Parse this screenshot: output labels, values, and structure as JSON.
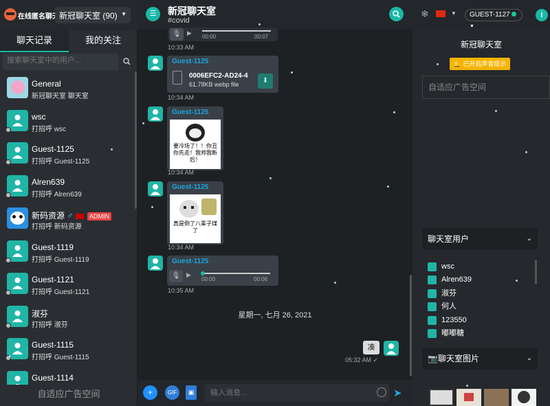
{
  "brand": {
    "name": "在线匿名聊天"
  },
  "room_select": {
    "label": "新冠聊天室 (90)"
  },
  "tabs": [
    {
      "label": "聊天记录"
    },
    {
      "label": "我的关注"
    }
  ],
  "search": {
    "placeholder": "搜索聊天室中的用户..."
  },
  "contacts": [
    {
      "name": "General",
      "message": "新冠聊天室 聊天室"
    },
    {
      "name": "wsc",
      "message": "打招呼 wsc"
    },
    {
      "name": "Guest-1125",
      "message": "打招呼 Guest-1125"
    },
    {
      "name": "Alren639",
      "message": "打招呼 Alren639"
    },
    {
      "name": "新码资源",
      "message": "打招呼 新码资源",
      "badge": "ADMIN"
    },
    {
      "name": "Guest-1119",
      "message": "打招呼 Guest-1119"
    },
    {
      "name": "Guest-1121",
      "message": "打招呼 Guest-1121"
    },
    {
      "name": "淑芬",
      "message": "打招呼 淑芬"
    },
    {
      "name": "Guest-1115",
      "message": "打招呼 Guest-1115"
    },
    {
      "name": "Guest-1114",
      "message": ""
    }
  ],
  "left_ad": "自适应广告空间",
  "chat": {
    "title": "新冠聊天室",
    "tag": "#covid",
    "messages": [
      {
        "time": "10:33 AM",
        "audio": {
          "start": "00:00",
          "end": "00:07"
        }
      },
      {
        "sender": "Guest-1125",
        "file_name": "0006EFC2-AD24-4",
        "file_size": "61.78KB webp file",
        "time": "10:34 AM"
      },
      {
        "sender": "Guest-1125",
        "sticker_text": "要冷场了！！你丑你先走！我帅我断后！",
        "time": "10:34 AM"
      },
      {
        "sender": "Guest-1125",
        "sticker_text": "真是倒了八辈子煤了",
        "time": "10:34 AM"
      },
      {
        "sender": "Guest-1125",
        "audio": {
          "start": "00:00",
          "end": "00:06"
        },
        "time": "10:35 AM"
      }
    ],
    "date_divider": "星期一, 七月 26, 2021",
    "my_message": {
      "text": "凑",
      "time": "05:32 AM"
    },
    "compose_placeholder": "输入消息..."
  },
  "right": {
    "user_button": "GUEST-1127",
    "room_title": "新冠聊天室",
    "sound_label": "已开启声音提示",
    "ad_label": "自适应广告空间",
    "users_panel": "聊天室用户",
    "users": [
      "wsc",
      "Alren639",
      "淑芬",
      "何人",
      "123550",
      "嘟嘟糖"
    ],
    "images_panel": "聊天室图片"
  },
  "colors": {
    "accent": "#19b8a6",
    "sender": "#19a7e0",
    "admin": "#e64545",
    "sound": "#f5b400"
  }
}
